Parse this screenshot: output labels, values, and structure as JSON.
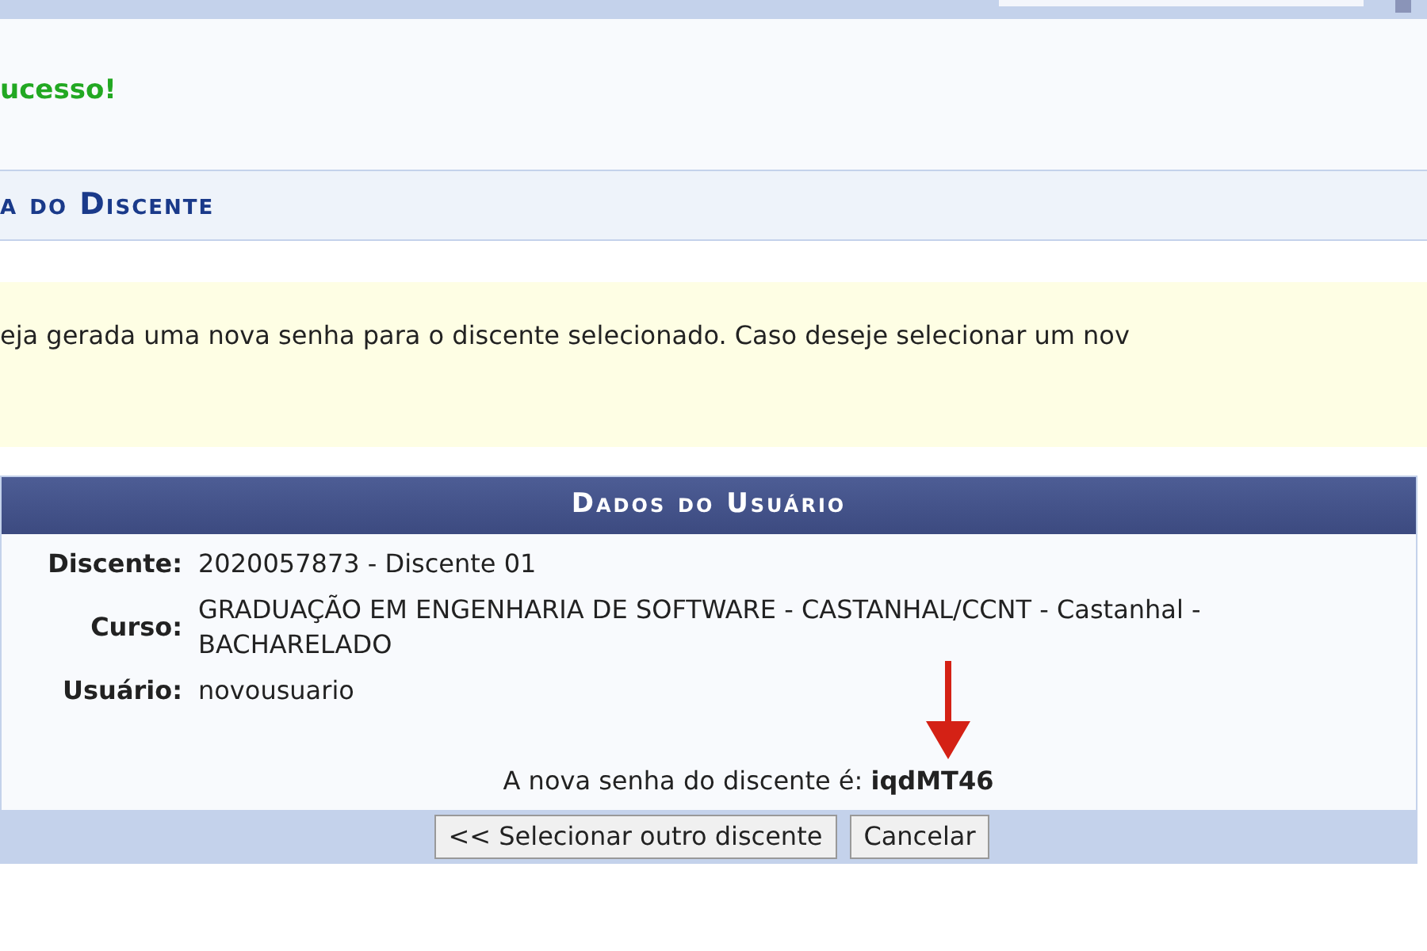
{
  "message": {
    "text": "ucesso!"
  },
  "section_title": "a do Discente",
  "notice": "eja gerada uma nova senha para o discente selecionado. Caso deseje selecionar um nov",
  "user_data": {
    "title": "Dados do Usuário",
    "fields": [
      {
        "label": "Discente:",
        "value": "2020057873 - Discente 01"
      },
      {
        "label": "Curso:",
        "value": "GRADUAÇÃO EM ENGENHARIA DE SOFTWARE - CASTANHAL/CCNT - Castanhal - BACHARELADO"
      },
      {
        "label": "Usuário:",
        "value": "novousuario"
      }
    ],
    "password_line": "A nova senha do discente é: **iqdMT46**"
  },
  "buttons": [
    "<< Selecionar outro discente",
    "Cancelar"
  ]
}
